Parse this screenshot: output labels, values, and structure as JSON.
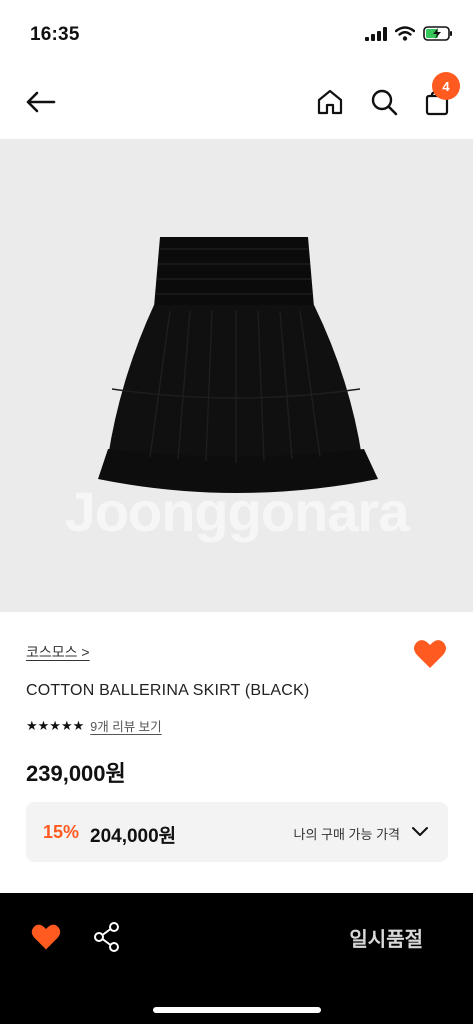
{
  "status_bar": {
    "time": "16:35"
  },
  "nav": {
    "cart_count": "4"
  },
  "image": {
    "watermark": "Joonggonara"
  },
  "product": {
    "brand": "코스모스 >",
    "title": "COTTON BALLERINA SKIRT (BLACK)",
    "stars": "★★★★★",
    "rating_value": 5,
    "review_link": "9개 리뷰 보기",
    "price": "239,000원"
  },
  "my_price": {
    "discount": "15%",
    "price": "204,000원",
    "label": "나의 구매 가능 가격"
  },
  "bottom_bar": {
    "soldout_label": "일시품절"
  },
  "colors": {
    "accent": "#ff5a1f",
    "bottom_bg": "#000000",
    "image_bg": "#ebebeb"
  }
}
